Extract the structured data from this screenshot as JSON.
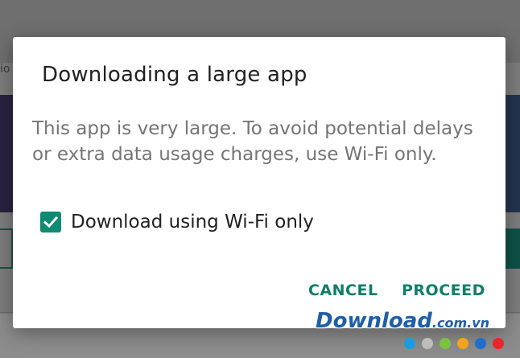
{
  "background": {
    "fragment_text": "io",
    "colors": {
      "scrim": "#7d7d7d"
    }
  },
  "dialog": {
    "title": "Downloading a large app",
    "message": "This app is very large. To avoid potential delays or extra data usage charges, use Wi-Fi only.",
    "checkbox": {
      "label": "Download using Wi-Fi only",
      "checked": true
    },
    "buttons": {
      "cancel": "CANCEL",
      "proceed": "PROCEED"
    },
    "accent_color": "#0f8a73"
  },
  "watermark": {
    "brand": "Download",
    "domain": ".com.vn",
    "dot_colors": [
      "#1e9be0",
      "#bdbdbd",
      "#7cc242",
      "#f7a21b",
      "#1e6fc9",
      "#e8262b"
    ]
  }
}
